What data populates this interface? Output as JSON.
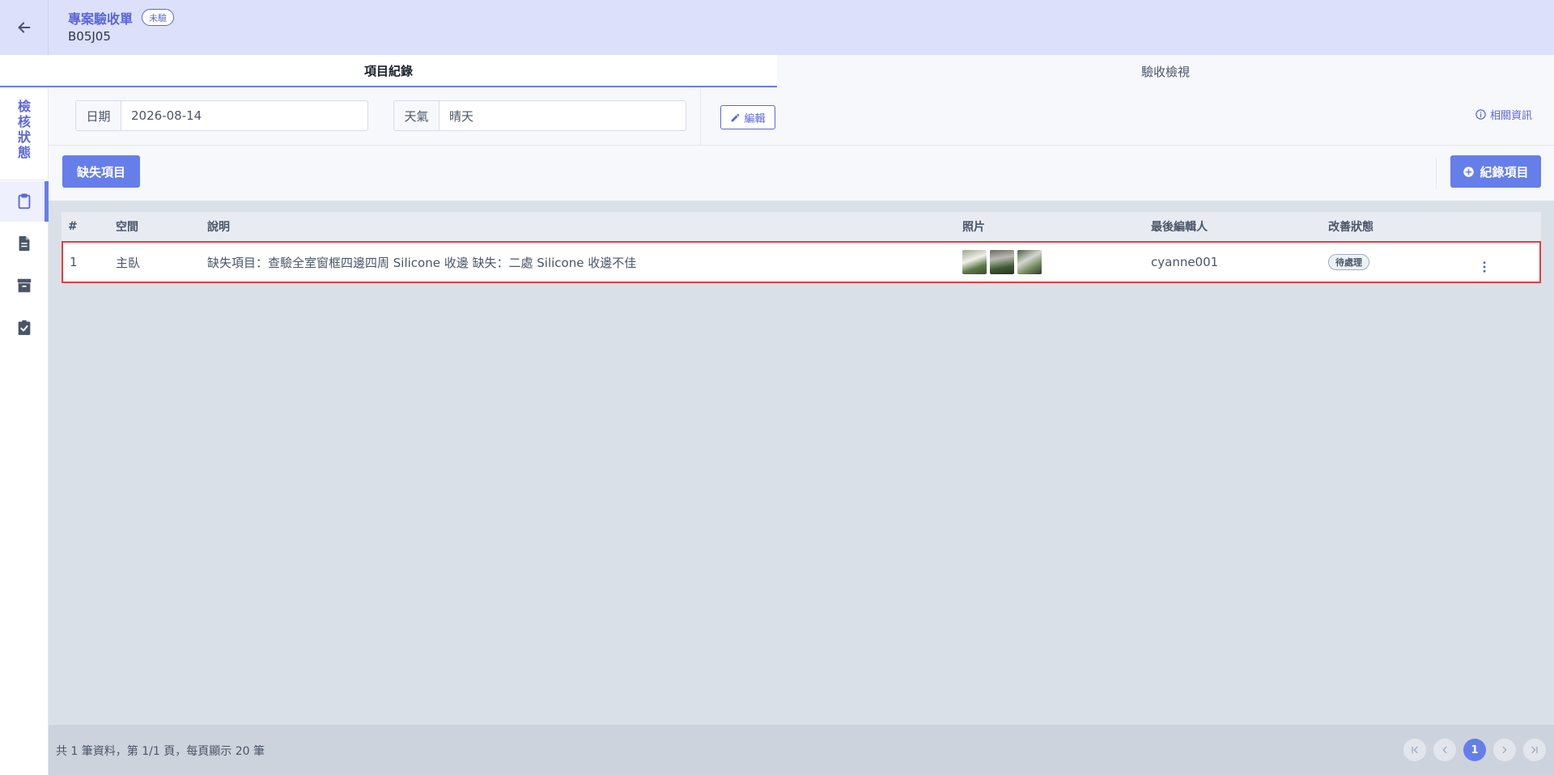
{
  "header": {
    "title": "專案驗收單",
    "badge": "未驗",
    "code": "B05J05"
  },
  "tabs": [
    {
      "label": "項目紀錄",
      "active": true
    },
    {
      "label": "驗收檢視",
      "active": false
    }
  ],
  "sidebar": {
    "label_chars": [
      "檢",
      "核",
      "狀",
      "態"
    ],
    "items": [
      {
        "icon": "clipboard-icon",
        "active": true
      },
      {
        "icon": "document-icon",
        "active": false
      },
      {
        "icon": "archive-icon",
        "active": false
      },
      {
        "icon": "clipboard-check-icon",
        "active": false
      }
    ]
  },
  "filters": {
    "date_label": "日期",
    "date_value": "2026-08-14",
    "weather_label": "天氣",
    "weather_value": "晴天",
    "edit_label": "編輯",
    "info_label": "相關資訊"
  },
  "actions": {
    "defect_label": "缺失項目",
    "add_label": "紀錄項目"
  },
  "table": {
    "headers": {
      "num": "#",
      "space": "空間",
      "desc": "說明",
      "photo": "照片",
      "editor": "最後編輯人",
      "status": "改善狀態"
    },
    "rows": [
      {
        "num": "1",
        "space": "主臥",
        "desc": "缺失項目：查驗全室窗框四邊四周 Silicone 收邊 缺失：二處 Silicone 收邊不佳",
        "photos": 3,
        "editor": "cyanne001",
        "status": "待處理"
      }
    ]
  },
  "footer": {
    "summary": "共 1 筆資料，第 1/1 頁，每頁顯示 20 筆",
    "current_page": "1"
  },
  "colors": {
    "accent": "#667eea",
    "header_bg": "#dde0fa",
    "row_border": "#e53e3e"
  }
}
